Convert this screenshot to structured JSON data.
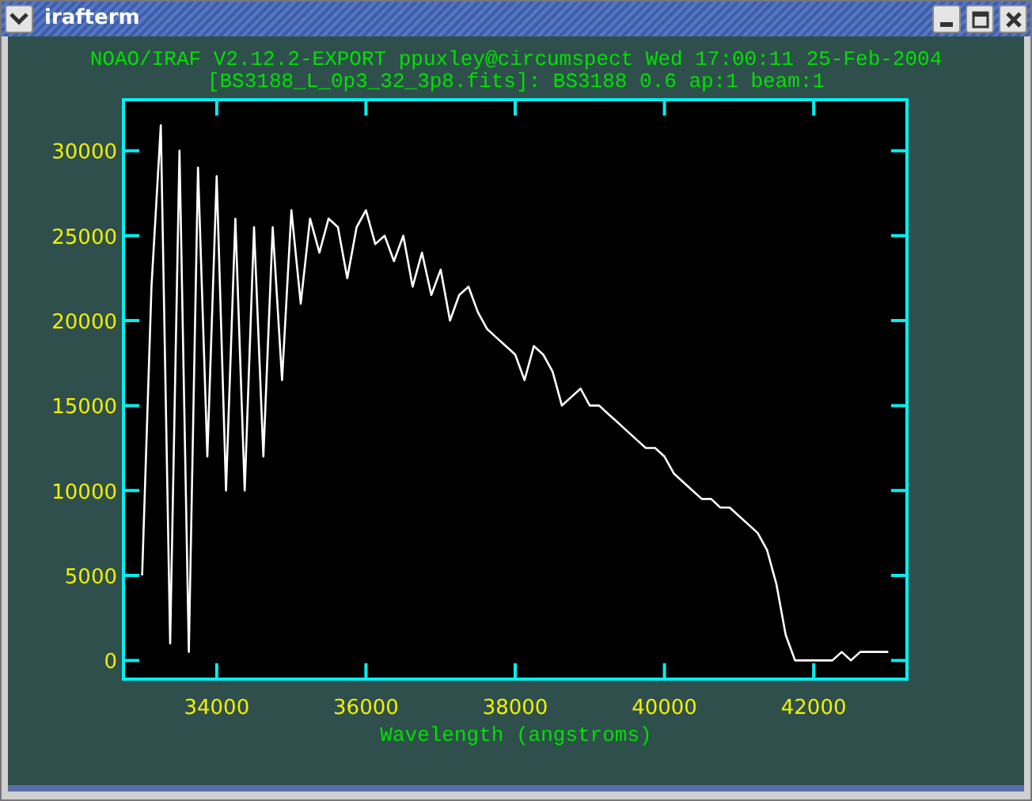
{
  "window": {
    "title": "irafterm"
  },
  "header": [
    "NOAO/IRAF V2.12.2-EXPORT ppuxley@circumspect Wed 17:00:11 25-Feb-2004",
    "[BS3188_L_0p3_32_3p8.fits]: BS3188 0.6 ap:1 beam:1"
  ],
  "plot": {
    "chart_data": {
      "type": "line",
      "xlabel": "Wavelength (angstroms)",
      "xlim": [
        32750,
        43250
      ],
      "ylim": [
        -1100,
        33000
      ],
      "xticks": [
        34000,
        36000,
        38000,
        40000,
        42000
      ],
      "yticks": [
        0,
        5000,
        10000,
        15000,
        20000,
        25000,
        30000
      ],
      "x": [
        33000,
        33125,
        33250,
        33375,
        33500,
        33625,
        33750,
        33875,
        34000,
        34125,
        34250,
        34375,
        34500,
        34625,
        34750,
        34875,
        35000,
        35125,
        35250,
        35375,
        35500,
        35625,
        35750,
        35875,
        36000,
        36125,
        36250,
        36375,
        36500,
        36625,
        36750,
        36875,
        37000,
        37125,
        37250,
        37375,
        37500,
        37625,
        37750,
        37875,
        38000,
        38125,
        38250,
        38375,
        38500,
        38625,
        38750,
        38875,
        39000,
        39125,
        39250,
        39375,
        39500,
        39625,
        39750,
        39875,
        40000,
        40125,
        40250,
        40375,
        40500,
        40625,
        40750,
        40875,
        41000,
        41125,
        41250,
        41375,
        41500,
        41625,
        41750,
        41875,
        42000,
        42125,
        42250,
        42375,
        42500,
        42625,
        42750,
        42875,
        43000
      ],
      "series": [
        {
          "color": "#ffffff",
          "values": [
            5000,
            22000,
            31500,
            1000,
            30000,
            500,
            29000,
            12000,
            28500,
            10000,
            26000,
            10000,
            25500,
            12000,
            25500,
            16500,
            26500,
            21000,
            26000,
            24000,
            26000,
            25500,
            22500,
            25500,
            26500,
            24500,
            25000,
            23500,
            25000,
            22000,
            24000,
            21500,
            23000,
            20000,
            21500,
            22000,
            20500,
            19500,
            19000,
            18500,
            18000,
            16500,
            18500,
            18000,
            17000,
            15000,
            15500,
            16000,
            15000,
            15000,
            14500,
            14000,
            13500,
            13000,
            12500,
            12500,
            12000,
            11000,
            10500,
            10000,
            9500,
            9500,
            9000,
            9000,
            8500,
            8000,
            7500,
            6500,
            4500,
            1500,
            0,
            0,
            0,
            0,
            0,
            500,
            0,
            500,
            500,
            500,
            500
          ]
        }
      ]
    }
  }
}
